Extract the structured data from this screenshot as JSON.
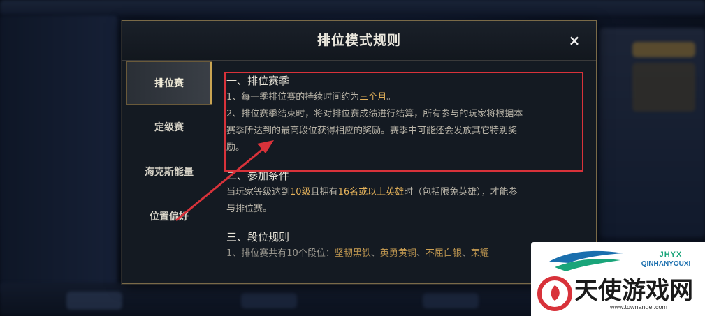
{
  "modal": {
    "title": "排位模式规则",
    "close_label": "×"
  },
  "tabs": [
    {
      "label": "排位赛",
      "active": true
    },
    {
      "label": "定级赛",
      "active": false
    },
    {
      "label": "海克斯能量",
      "active": false
    },
    {
      "label": "位置偏好",
      "active": false
    }
  ],
  "content": {
    "section1": {
      "heading": "一、排位赛季",
      "item1_prefix": "1、每一季排位赛的持续时间约为",
      "item1_highlight": "三个月",
      "item1_suffix": "。",
      "item2_line1": "2、排位赛季结束时，将对排位赛成绩进行结算，所有参与的玩家将根据本",
      "item2_line2": "赛季所达到的最高段位获得相应的奖励。赛季中可能还会发放其它特别奖",
      "item2_line3": "励。"
    },
    "section2": {
      "heading": "二、参加条件",
      "text_a": "当玩家等级达到",
      "text_b": "10级",
      "text_c": "且拥有",
      "text_d": "16名或以上英雄",
      "text_e": "时（包括限免英雄），才能参",
      "text_line2": "与排位赛。"
    },
    "section3": {
      "heading": "三、段位规则",
      "text_a": "1、排位赛共有10个段位：",
      "text_b": "坚韧黑铁",
      "text_c": "、",
      "text_d": "英勇黄铜",
      "text_e": "、",
      "text_f": "不屈白银",
      "text_g": "、",
      "text_h": "荣耀"
    }
  },
  "watermark": {
    "brand": "JHYX",
    "brand_sub": "QINHANYOUXI",
    "name": "天使游戏网",
    "url": "www.townangel.com"
  },
  "colors": {
    "highlight_gold": "#e3b15a",
    "annotation_red": "#d8323a",
    "modal_border": "#7a6a48"
  }
}
